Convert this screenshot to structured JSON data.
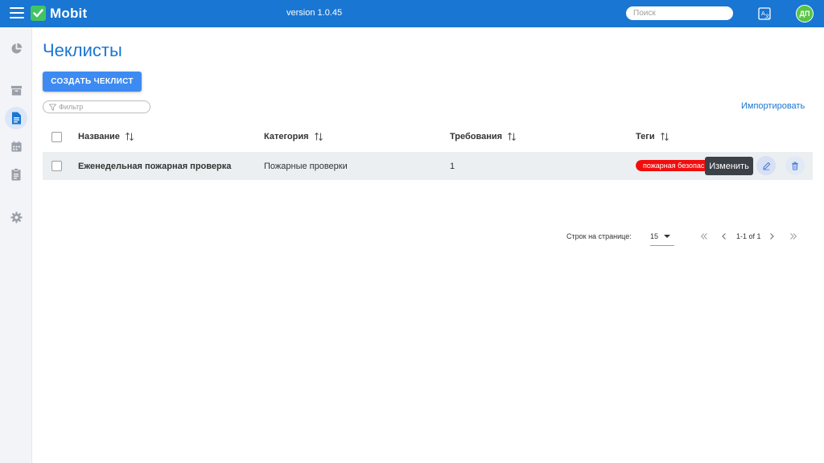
{
  "header": {
    "brand": "Mobit",
    "version": "version 1.0.45",
    "search_placeholder": "Поиск",
    "avatar_initials": "ДП",
    "bar_color": "#1976d2",
    "logo_color": "#43c463",
    "avatar_color": "#58c447"
  },
  "sidebar": {
    "items": [
      {
        "icon": "pie-chart-icon",
        "active": false
      },
      {
        "icon": "archive-icon",
        "active": false
      },
      {
        "icon": "document-icon",
        "active": true
      },
      {
        "icon": "calendar-icon",
        "active": false
      },
      {
        "icon": "clipboard-icon",
        "active": false
      },
      {
        "icon": "gear-icon",
        "active": false
      }
    ]
  },
  "main": {
    "title": "Чеклисты",
    "create_button": "СОЗДАТЬ ЧЕКЛИСТ",
    "filter_placeholder": "Фильтр",
    "import_link": "Импортировать"
  },
  "table": {
    "columns": [
      "Название",
      "Категория",
      "Требования",
      "Теги"
    ],
    "rows": [
      {
        "name": "Еженедельная пожарная проверка",
        "category": "Пожарные проверки",
        "requirements": "1",
        "tag": "пожарная безопасность",
        "tag_color": "#f20d0d"
      }
    ],
    "tooltip": "Изменить"
  },
  "pagination": {
    "rows_per_page_label": "Строк на странице:",
    "rows_per_page": "15",
    "range": "1-1 of 1"
  }
}
